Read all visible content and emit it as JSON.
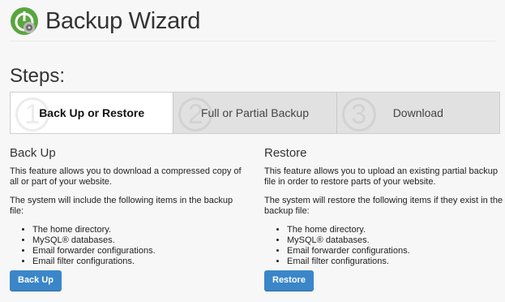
{
  "header": {
    "title": "Backup Wizard",
    "logo_icon": "backup-wizard-logo-icon"
  },
  "steps_label": "Steps:",
  "steps": [
    {
      "number": "1",
      "label": "Back Up or Restore",
      "active": true
    },
    {
      "number": "2",
      "label": "Full or Partial Backup",
      "active": false
    },
    {
      "number": "3",
      "label": "Download",
      "active": false
    }
  ],
  "backup": {
    "heading": "Back Up",
    "description": "This feature allows you to download a compressed copy of all or part of your website.",
    "includes_intro": "The system will include the following items in the backup file:",
    "items": [
      "The home directory.",
      "MySQL® databases.",
      "Email forwarder configurations.",
      "Email filter configurations."
    ],
    "button_label": "Back Up"
  },
  "restore": {
    "heading": "Restore",
    "description": "This feature allows you to upload an existing partial backup file in order to restore parts of your website.",
    "includes_intro": "The system will restore the following items if they exist in the backup file:",
    "items": [
      "The home directory.",
      "MySQL® databases.",
      "Email forwarder configurations.",
      "Email filter configurations."
    ],
    "button_label": "Restore"
  },
  "colors": {
    "button": "#3a86c9",
    "logo_green": "#5aa53e"
  }
}
